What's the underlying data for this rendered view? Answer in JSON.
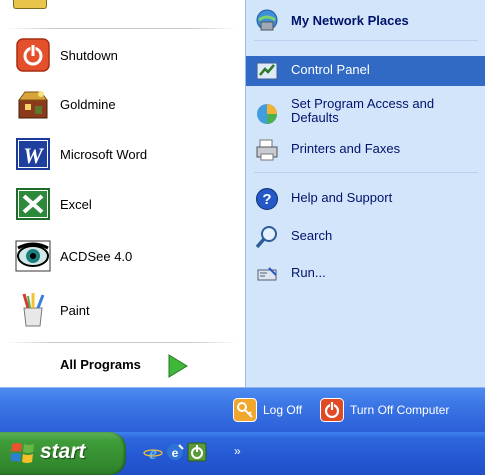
{
  "left_panel": {
    "programs": [
      {
        "label": "Shutdown",
        "icon": "shutdown-icon"
      },
      {
        "label": "Goldmine",
        "icon": "goldmine-icon"
      },
      {
        "label": "Microsoft Word",
        "icon": "word-icon"
      },
      {
        "label": "Excel",
        "icon": "excel-icon"
      },
      {
        "label": "ACDSee 4.0",
        "icon": "acdsee-icon"
      },
      {
        "label": "Paint",
        "icon": "paint-icon"
      }
    ],
    "all_programs_label": "All Programs"
  },
  "right_panel": {
    "items": [
      {
        "label": "My Network Places",
        "icon": "network-places-icon",
        "bold": true
      },
      {
        "label": "Control Panel",
        "icon": "control-panel-icon",
        "selected": true
      },
      {
        "label_line1": "Set Program Access and",
        "label_line2": "Defaults",
        "icon": "program-access-icon"
      },
      {
        "label": "Printers and Faxes",
        "icon": "printer-icon"
      },
      {
        "label": "Help and Support",
        "icon": "help-icon"
      },
      {
        "label": "Search",
        "icon": "search-icon"
      },
      {
        "label": "Run...",
        "icon": "run-icon"
      }
    ]
  },
  "bottom_bar": {
    "logoff_label": "Log Off",
    "turnoff_label": "Turn Off Computer"
  },
  "taskbar": {
    "start_label": "start",
    "chevron": "»",
    "quicklaunch": [
      "internet-explorer-icon",
      "outlook-express-icon",
      "shutdown-icon"
    ]
  },
  "colors": {
    "selection": "#316ac5",
    "right_pane_bg": "#d3e5fa",
    "taskbar_blue": "#2458d2",
    "start_green": "#3f9d3a"
  }
}
